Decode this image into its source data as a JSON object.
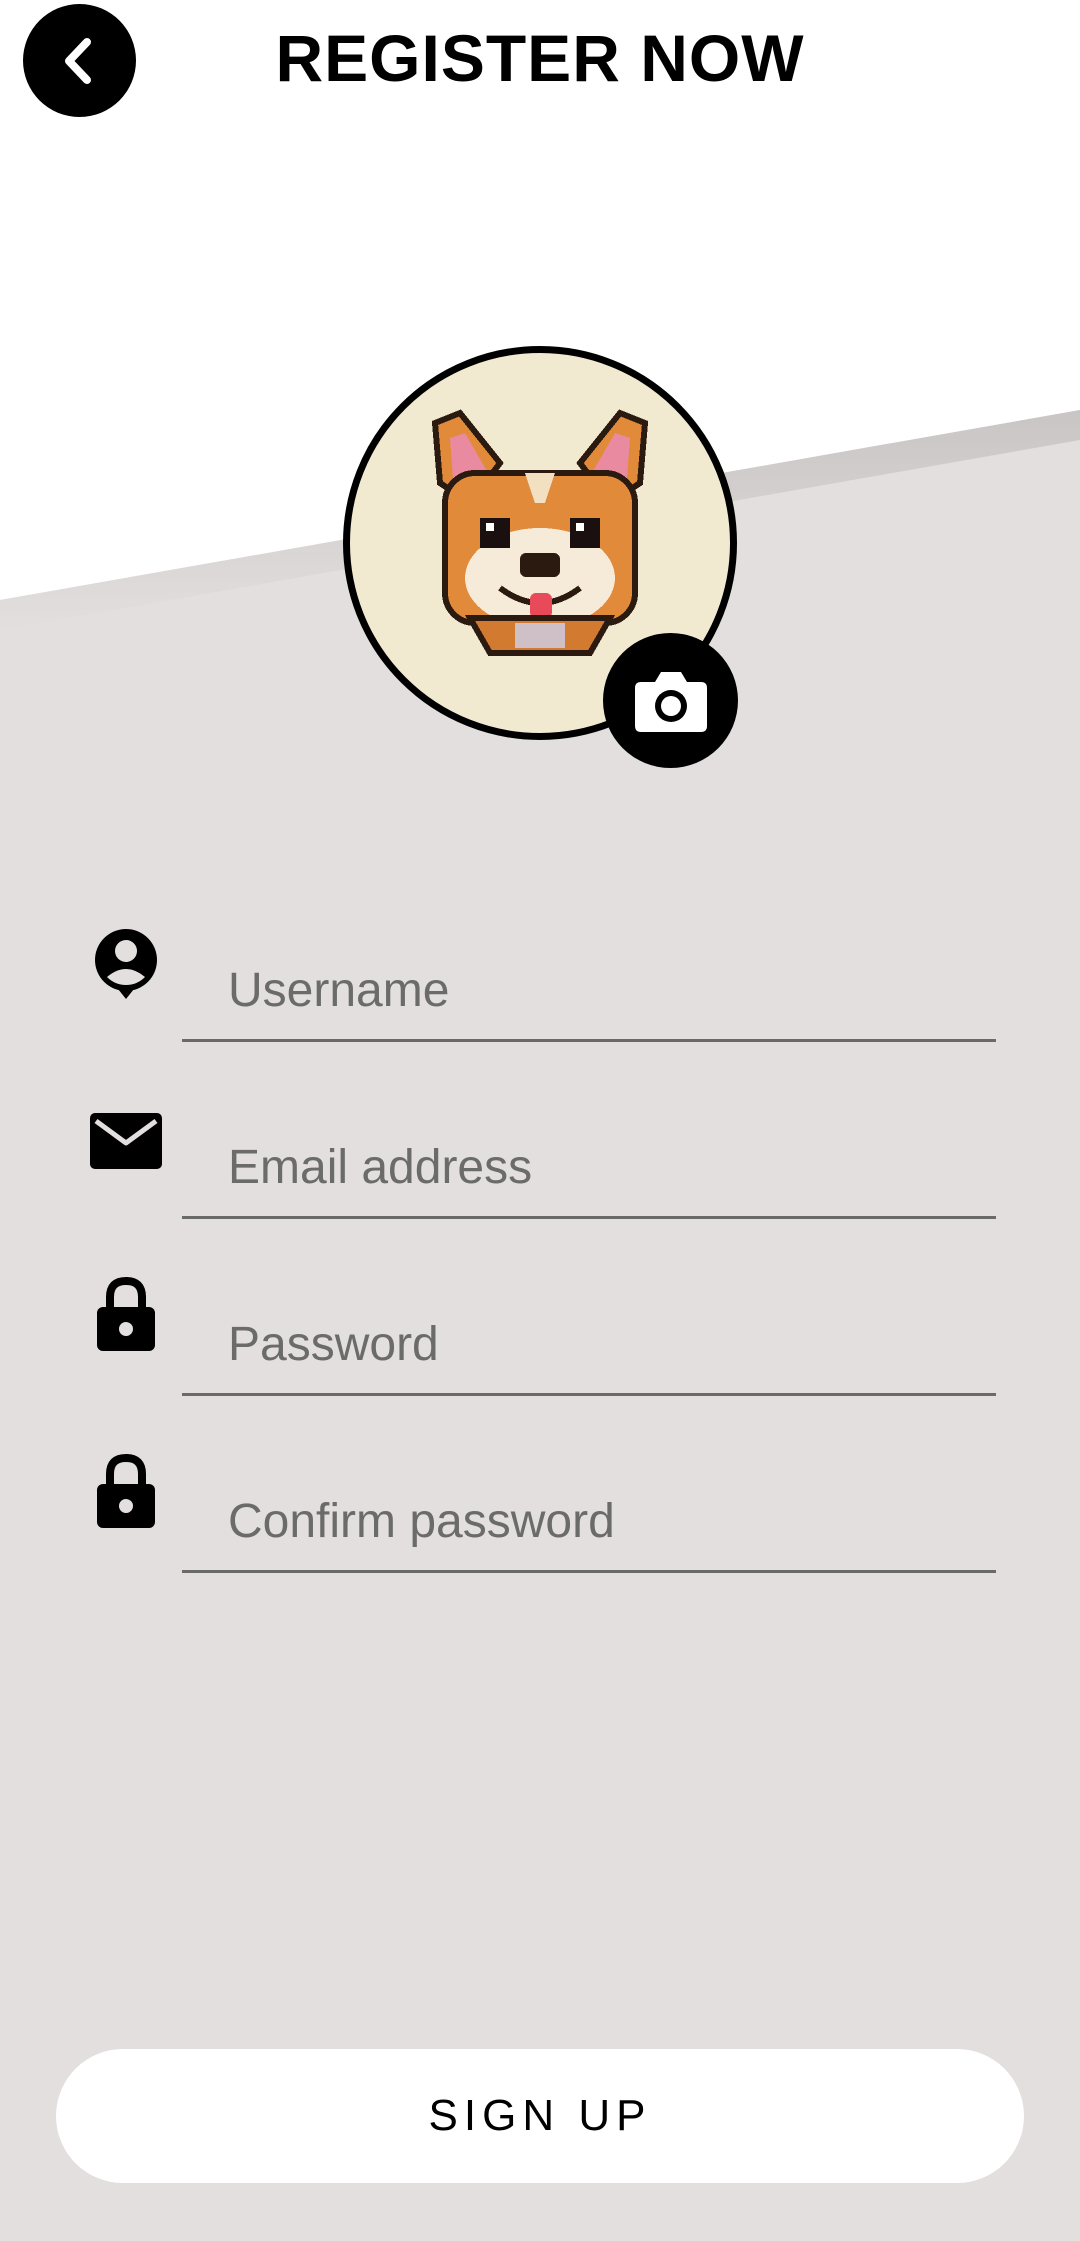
{
  "header": {
    "title": "REGISTER NOW"
  },
  "form": {
    "username_placeholder": "Username",
    "email_placeholder": "Email address",
    "password_placeholder": "Password",
    "confirm_password_placeholder": "Confirm password"
  },
  "actions": {
    "signup_label": "SIGN UP"
  },
  "icons": {
    "back": "back-arrow-icon",
    "camera": "camera-icon",
    "username": "user-icon",
    "email": "mail-icon",
    "password": "lock-icon"
  },
  "colors": {
    "background": "#e3dfdf",
    "accent": "#000000",
    "input_line": "#6a6a6a"
  }
}
